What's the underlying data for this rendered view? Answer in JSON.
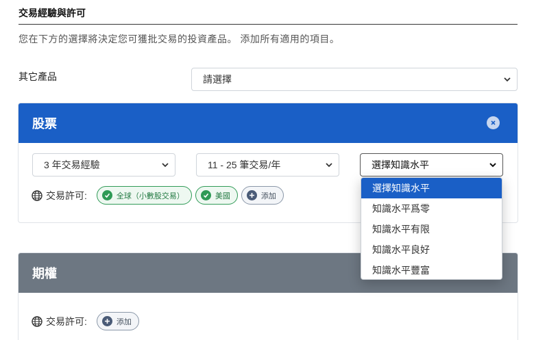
{
  "header": {
    "title": "交易經驗與許可",
    "description": "您在下方的選擇將決定您可獲批交易的投資產品。 添加所有適用的項目。"
  },
  "other_products": {
    "label": "其它產品",
    "select_value": "請選擇"
  },
  "stocks": {
    "title": "股票",
    "experience_value": "3 年交易經驗",
    "frequency_value": "11 - 25 筆交易/年",
    "knowledge_value": "選擇知識水平",
    "permissions_label": "交易許可:",
    "permissions": [
      "全球（小數股交易）",
      "美國"
    ],
    "add_label": "添加"
  },
  "knowledge_dropdown": {
    "options": [
      "選擇知識水平",
      "知識水平爲零",
      "知識水平有限",
      "知識水平良好",
      "知識水平豐富"
    ],
    "selected_index": 0
  },
  "options": {
    "title": "期權",
    "permissions_label": "交易許可:",
    "add_label": "添加"
  },
  "colors": {
    "stocks_header": "#1a5fc6",
    "options_header": "#6d7782",
    "permission_green": "#2f9a56"
  }
}
